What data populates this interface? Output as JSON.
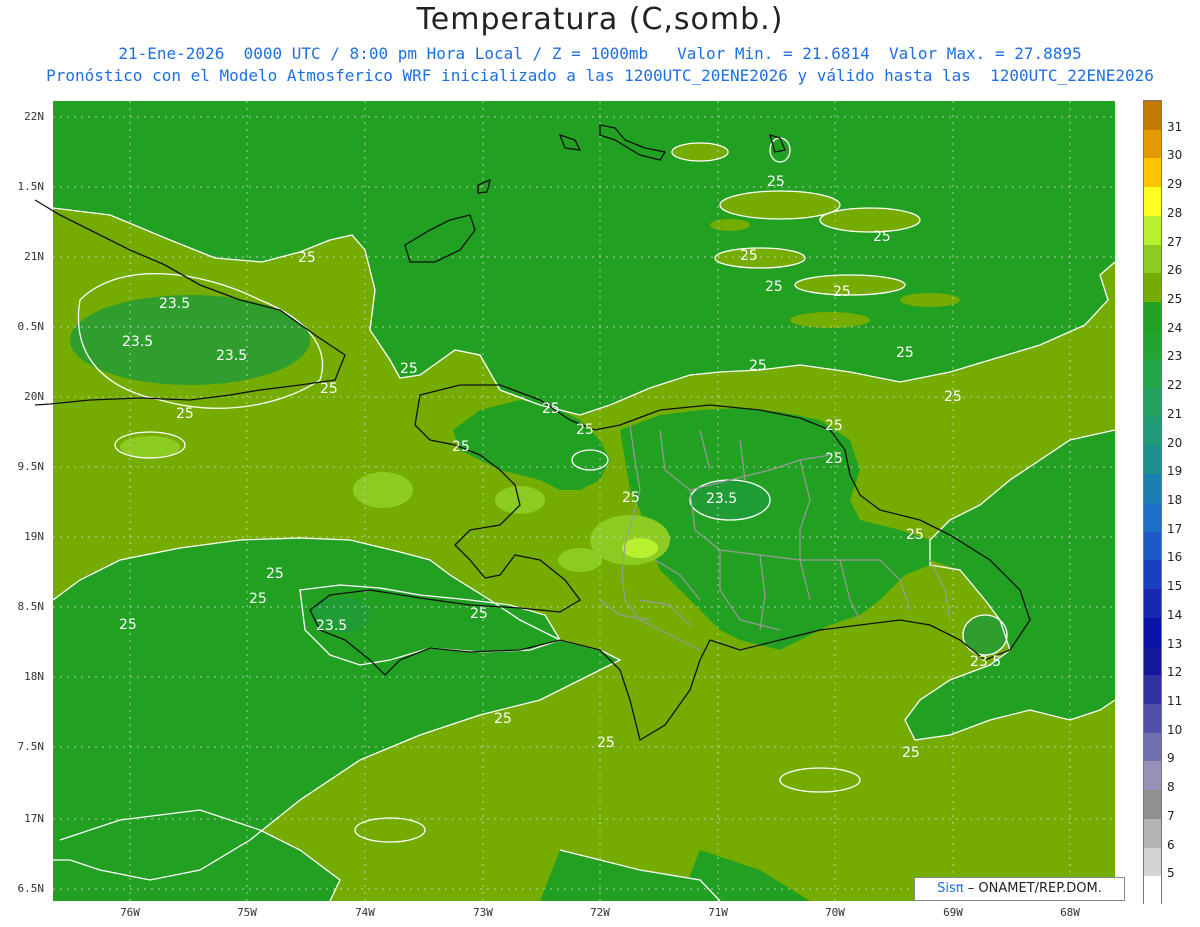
{
  "title": "Temperatura (C,somb.)",
  "subtitle_line1": "21-Ene-2026  0000 UTC / 8:00 pm Hora Local / Z = 1000mb   Valor Min. = 21.6814  Valor Max. = 27.8895",
  "subtitle_line2": "Pronóstico con el Modelo Atmosferico WRF inicializado a las 1200UTC_20ENE2026 y válido hasta las  1200UTC_22ENE2026",
  "lat_labels": [
    "22N",
    "1.5N",
    "21N",
    "0.5N",
    "20N",
    "9.5N",
    "19N",
    "8.5N",
    "18N",
    "7.5N",
    "17N",
    "6.5N"
  ],
  "lon_labels": [
    "76W",
    "75W",
    "74W",
    "73W",
    "72W",
    "71W",
    "70W",
    "69W",
    "68W"
  ],
  "colorbar": {
    "labels": [
      "31",
      "30",
      "29",
      "28",
      "27",
      "26",
      "25",
      "24",
      "23",
      "22",
      "21",
      "20",
      "19",
      "18",
      "17",
      "16",
      "15",
      "14",
      "13",
      "12",
      "11",
      "10",
      "9",
      "8",
      "7",
      "6",
      "5"
    ],
    "colors": [
      "#c47a00",
      "#e29a00",
      "#ffc400",
      "#ffff22",
      "#b8f030",
      "#8ccc22",
      "#74ac00",
      "#22a022",
      "#1fa530",
      "#23a748",
      "#22a060",
      "#1f9a78",
      "#1a9090",
      "#1a7fb0",
      "#1e6fc8",
      "#1f58c8",
      "#1a40c0",
      "#1428b0",
      "#0a14a8",
      "#14189a",
      "#3030a0",
      "#5050a8",
      "#7070b0",
      "#9a90b8",
      "#909090",
      "#b4b4b4",
      "#d4d4d4",
      "#ffffff"
    ]
  },
  "contour_labels": [
    "25",
    "25",
    "25",
    "25",
    "25",
    "25",
    "25",
    "25",
    "25",
    "25",
    "25",
    "25",
    "25",
    "25",
    "25",
    "25",
    "25",
    "25",
    "25",
    "25",
    "25",
    "25",
    "25",
    "25",
    "25",
    "25",
    "23.5",
    "23.5",
    "23.5",
    "23.5",
    "23.5",
    "23.5"
  ],
  "credit": {
    "brand": "Sisπ",
    "text": "– ONAMET/REP.DOM."
  },
  "colors": {
    "sea_green": "#22a022",
    "land_olive": "#74ac00",
    "contour": "#ffffff",
    "subtitle": "#1f6fe0"
  }
}
